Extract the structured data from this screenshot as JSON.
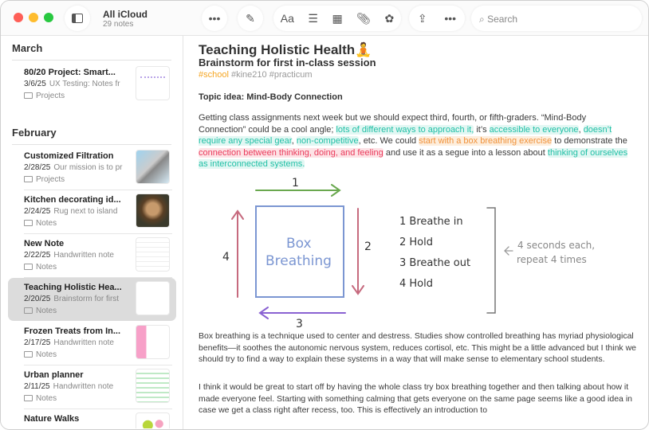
{
  "toolbar": {
    "folder_title": "All iCloud",
    "note_count": "29 notes",
    "search_placeholder": "Search",
    "format_label": "Aa"
  },
  "sidebar": {
    "sections": [
      "March",
      "February"
    ],
    "notes": [
      {
        "title": "80/20 Project: Smart...",
        "date": "3/6/25",
        "preview": "UX Testing: Notes fr",
        "folder": "Projects"
      },
      {
        "title": "Customized Filtration",
        "date": "2/28/25",
        "preview": "Our mission is to pr",
        "folder": "Projects"
      },
      {
        "title": "Kitchen decorating id...",
        "date": "2/24/25",
        "preview": "Rug next to island",
        "folder": "Notes"
      },
      {
        "title": "New Note",
        "date": "2/22/25",
        "preview": "Handwritten note",
        "folder": "Notes"
      },
      {
        "title": "Teaching Holistic Hea...",
        "date": "2/20/25",
        "preview": "Brainstorm for first",
        "folder": "Notes"
      },
      {
        "title": "Frozen Treats from In...",
        "date": "2/17/25",
        "preview": "Handwritten note",
        "folder": "Notes"
      },
      {
        "title": "Urban planner",
        "date": "2/11/25",
        "preview": "Handwritten note",
        "folder": "Notes"
      },
      {
        "title": "Nature Walks"
      }
    ]
  },
  "note": {
    "title": "Teaching Holistic Health🧘",
    "subtitle": "Brainstorm for first in-class session",
    "tags": [
      "#school",
      "#kine210",
      "#practicum"
    ],
    "topic": "Topic idea: Mind-Body Connection",
    "p1": [
      "Getting class assignments next week but we should expect third, fourth, or fifth-graders. “Mind-Body Connection” could be a cool angle; ",
      "lots of different ways to approach it,",
      " it’s ",
      "accessible to everyone",
      ", ",
      "doesn’t require any special gear",
      ", ",
      "non-competitive",
      ", etc. We could ",
      "start with a box breathing exercise",
      " to demonstrate the ",
      "connection between thinking, doing, and feeling",
      " and use it as a segue into a lesson about ",
      "thinking of ourselves as interconnected systems."
    ],
    "drawing": {
      "box_label_1": "Box",
      "box_label_2": "Breathing",
      "arrows": [
        "1",
        "2",
        "3",
        "4"
      ],
      "steps": [
        "1  Breathe in",
        "2  Hold",
        "3  Breathe out",
        "4  Hold"
      ],
      "note_1": "4 seconds each,",
      "note_2": "repeat 4 times"
    },
    "p2": "Box breathing is a technique used to center and destress. Studies show controlled breathing has myriad physiological benefits—it soothes the autonomic nervous system, reduces cortisol, etc. This might be a little advanced but I think we should try to find a way to explain these systems in a way that will make sense to elementary school students.",
    "p3": "I think it would be great to start off by having the whole class try box breathing together and then talking about how it made everyone feel. Starting with something calming that gets everyone on the same page seems like a good idea in case we get a class right after recess, too. This is effectively an introduction to"
  },
  "colors": {
    "tag_school": "#f5a623",
    "teal": "#1fbfa5",
    "orange": "#f0913a",
    "red": "#ea3b5c"
  }
}
